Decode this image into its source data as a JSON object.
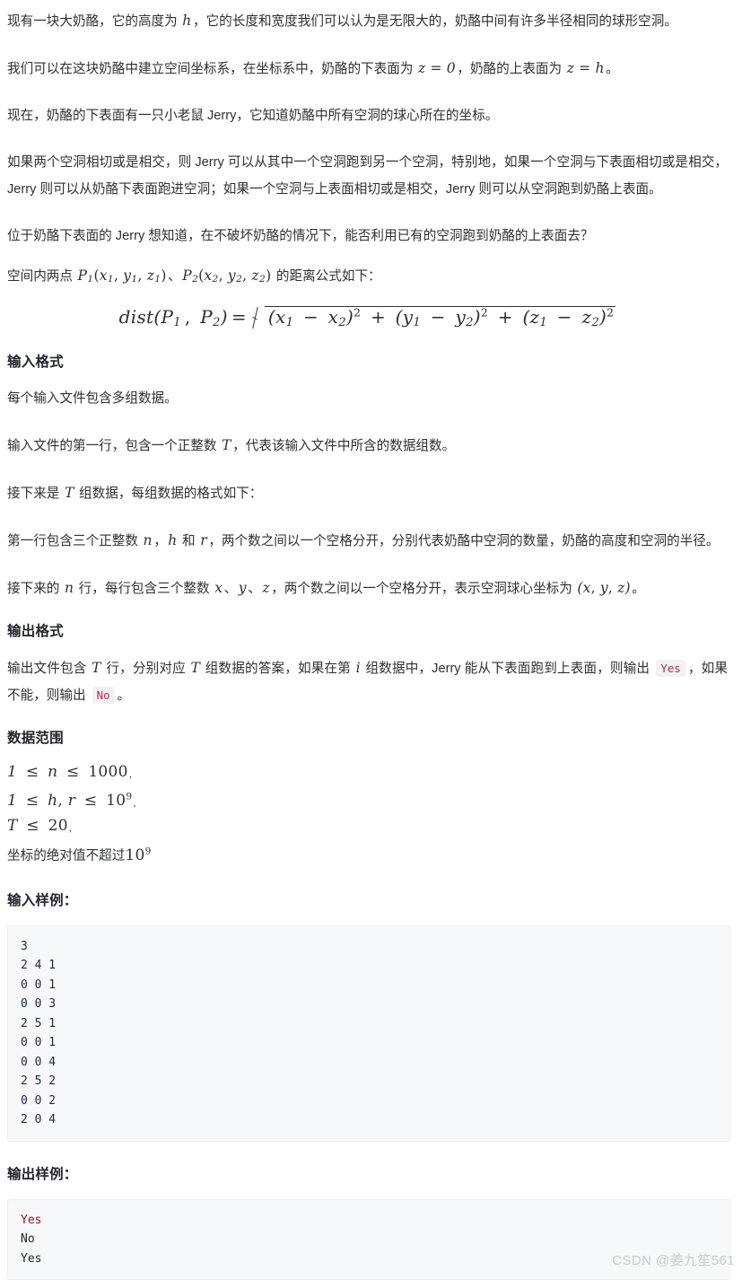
{
  "document": {
    "paragraphs": [
      {
        "id": "p1",
        "segments": [
          {
            "type": "text",
            "value": "现有一块大奶酪，它的高度为 "
          },
          {
            "type": "math",
            "value": "h"
          },
          {
            "type": "text",
            "value": "，它的长度和宽度我们可以认为是无限大的，奶酪中间有许多半径相同的球形空洞。"
          }
        ]
      },
      {
        "id": "p2",
        "segments": [
          {
            "type": "text",
            "value": "我们可以在这块奶酪中建立空间坐标系，在坐标系中，奶酪的下表面为 "
          },
          {
            "type": "math",
            "value": "z = 0"
          },
          {
            "type": "text",
            "value": "，奶酪的上表面为 "
          },
          {
            "type": "math",
            "value": "z = h"
          },
          {
            "type": "text",
            "value": "。"
          }
        ]
      },
      {
        "id": "p3",
        "segments": [
          {
            "type": "text",
            "value": "现在，奶酪的下表面有一只小老鼠 Jerry，它知道奶酪中所有空洞的球心所在的坐标。"
          }
        ]
      },
      {
        "id": "p4",
        "segments": [
          {
            "type": "text",
            "value": "如果两个空洞相切或是相交，则 Jerry 可以从其中一个空洞跑到另一个空洞，特别地，如果一个空洞与下表面相切或是相交，Jerry 则可以从奶酪下表面跑进空洞；如果一个空洞与上表面相切或是相交，Jerry 则可以从空洞跑到奶酪上表面。"
          }
        ]
      },
      {
        "id": "p5",
        "segments": [
          {
            "type": "text",
            "value": "位于奶酪下表面的 Jerry 想知道，在不破坏奶酪的情况下，能否利用已有的空洞跑到奶酪的上表面去？"
          }
        ]
      }
    ],
    "distance_intro": {
      "prefix": "空间内两点 ",
      "point1": "P",
      "point1_sub": "1",
      "point1_args": "(x₁, y₁, z₁)",
      "separator": "、",
      "point2": "P",
      "point2_sub": "2",
      "point2_args": "(x₂, y₂, z₂)",
      "suffix": " 的距离公式如下："
    },
    "formula": {
      "latex": "dist(P_1, P_2) = \\sqrt{(x_1 - x_2)^2 + (y_1 - y_2)^2 + (z_1 - z_2)^2}",
      "plain": "dist(P1, P2) = √((x1 − x2)² + (y1 − y2)² + (z1 − z2)²)",
      "lhs_name": "dist"
    },
    "sections": {
      "input_format": {
        "heading": "输入格式",
        "lines": [
          {
            "id": "i1",
            "text": "每个输入文件包含多组数据。"
          },
          {
            "id": "i2",
            "prefix": "输入文件的第一行，包含一个正整数 ",
            "math": "T",
            "suffix": "，代表该输入文件中所含的数据组数。"
          },
          {
            "id": "i3",
            "prefix": "接下来是 ",
            "math": "T",
            "suffix": " 组数据，每组数据的格式如下："
          },
          {
            "id": "i4",
            "prefix": "第一行包含三个正整数 ",
            "math": "n",
            "mid1": "，",
            "math2": "h",
            "mid2": " 和 ",
            "math3": "r",
            "suffix": "，两个数之间以一个空格分开，分别代表奶酪中空洞的数量，奶酪的高度和空洞的半径。"
          },
          {
            "id": "i5",
            "prefix": "接下来的 ",
            "math": "n",
            "mid1": " 行，每行包含三个整数 ",
            "math2": "x",
            "mid2": "、",
            "math3": "y",
            "mid3": "、",
            "math4": "z",
            "suffix": "，两个数之间以一个空格分开，表示空洞球心坐标为 ",
            "coords": "(x, y, z)",
            "tail": "。"
          }
        ]
      },
      "output_format": {
        "heading": "输出格式",
        "line": {
          "s1": "输出文件包含 ",
          "m1": "T",
          "s2": " 行，分别对应 ",
          "m2": "T",
          "s3": " 组数据的答案，如果在第 ",
          "m3": "i",
          "s4": " 组数据中，Jerry 能从下表面跑到上表面，则输出 ",
          "code_yes": "Yes",
          "s5": "，如果不能，则输出 ",
          "code_no": "No",
          "s6": "。"
        }
      },
      "data_range": {
        "heading": "数据范围",
        "constraints": [
          {
            "id": "c1",
            "math": "1 ≤ n ≤ 1000",
            "trailing": ","
          },
          {
            "id": "c2",
            "math": "1 ≤ h, r ≤ 10⁹",
            "trailing": ","
          },
          {
            "id": "c3",
            "math": "T ≤ 20",
            "trailing": ","
          },
          {
            "id": "c4",
            "text": "坐标的绝对值不超过",
            "math": "10⁹",
            "trailing": ""
          }
        ]
      },
      "input_sample": {
        "heading": "输入样例：",
        "lines": [
          "3",
          "2 4 1",
          "0 0 1",
          "0 0 3",
          "2 5 1",
          "0 0 1",
          "0 0 4",
          "2 5 2",
          "0 0 2",
          "2 0 4"
        ]
      },
      "output_sample": {
        "heading": "输出样例：",
        "lines": [
          {
            "text": "Yes",
            "highlight": true
          },
          {
            "text": "No",
            "highlight": false
          },
          {
            "text": "Yes",
            "highlight": false
          }
        ]
      }
    },
    "watermark": "CSDN @姜九笙561"
  },
  "colors": {
    "text": "#2f3034",
    "heading": "#23252b",
    "code_bg": "#f7f8f9",
    "code_border": "#eceef0",
    "chip_bg": "#f2f2f3",
    "chip_text": "#c7254e",
    "code_number": "#1c2b4a",
    "code_keyword": "#a31515",
    "watermark": "#c9ccd1"
  }
}
